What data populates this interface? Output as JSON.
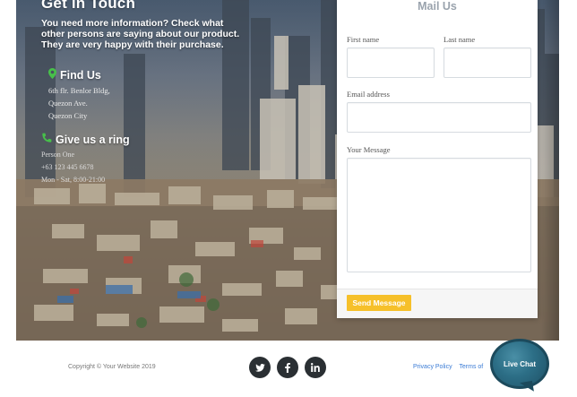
{
  "hero": {
    "title": "Get in Touch",
    "lead": "You need more information? Check what other persons are saying about our product. They are very happy with their purchase.",
    "find_us": {
      "heading": "Find Us",
      "icon": "map-marker-icon",
      "lines": [
        "6th flr. Benlor Bldg,",
        "Quezon Ave.",
        "Quezon City"
      ]
    },
    "ring": {
      "heading": "Give us a ring",
      "icon": "phone-icon",
      "lines": [
        "Person One",
        "+63 123 445 6678",
        "Mon - Sat, 8:00-21:00"
      ]
    },
    "accent_color": "#47c04a"
  },
  "form": {
    "title": "Mail Us",
    "first_name_label": "First name",
    "last_name_label": "Last name",
    "email_label": "Email address",
    "message_label": "Your Message",
    "send_label": "Send Message",
    "send_color": "#f6c02a"
  },
  "footer": {
    "copyright": "Copyright © Your Website 2019",
    "social": [
      {
        "name": "twitter-icon",
        "glyph": "🐦"
      },
      {
        "name": "facebook-icon",
        "glyph": "f"
      },
      {
        "name": "linkedin-icon",
        "glyph": "in"
      }
    ],
    "links": [
      "Privacy Policy",
      "Terms of"
    ],
    "chat_label": "Live Chat"
  }
}
